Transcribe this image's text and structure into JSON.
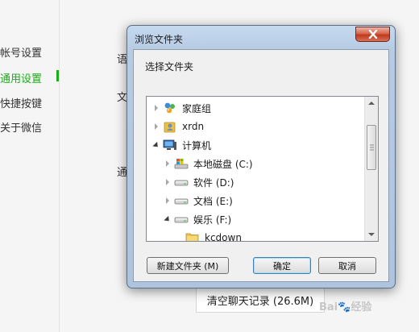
{
  "background": {
    "sidebar": {
      "items": [
        {
          "label": "帐号设置"
        },
        {
          "label": "通用设置",
          "active": true
        },
        {
          "label": "快捷按键"
        },
        {
          "label": "关于微信"
        }
      ]
    },
    "main": {
      "labels": [
        "语",
        "文",
        "通"
      ],
      "clear_button_label": "清空聊天记录 (26.6M)"
    },
    "accent_color": "#1aad19"
  },
  "dialog": {
    "title": "浏览文件夹",
    "close_icon": "close-icon",
    "prompt": "选择文件夹",
    "tree": [
      {
        "label": "家庭组",
        "icon": "homegroup-icon",
        "expanded": false
      },
      {
        "label": "xrdn",
        "icon": "user-folder-icon",
        "expanded": false
      },
      {
        "label": "计算机",
        "icon": "computer-icon",
        "expanded": true
      },
      {
        "label": "本地磁盘 (C:)",
        "icon": "system-drive-icon",
        "expanded": false
      },
      {
        "label": "软件 (D:)",
        "icon": "drive-icon",
        "expanded": false
      },
      {
        "label": "文档 (E:)",
        "icon": "drive-icon",
        "expanded": false
      },
      {
        "label": "娱乐 (F:)",
        "icon": "drive-icon",
        "expanded": true
      },
      {
        "label": "kcdown",
        "icon": "folder-icon",
        "expanded": false
      }
    ],
    "buttons": {
      "new_folder": "新建文件夹 (M)",
      "ok": "确定",
      "cancel": "取消"
    }
  },
  "watermark": "Bai🐾经验"
}
